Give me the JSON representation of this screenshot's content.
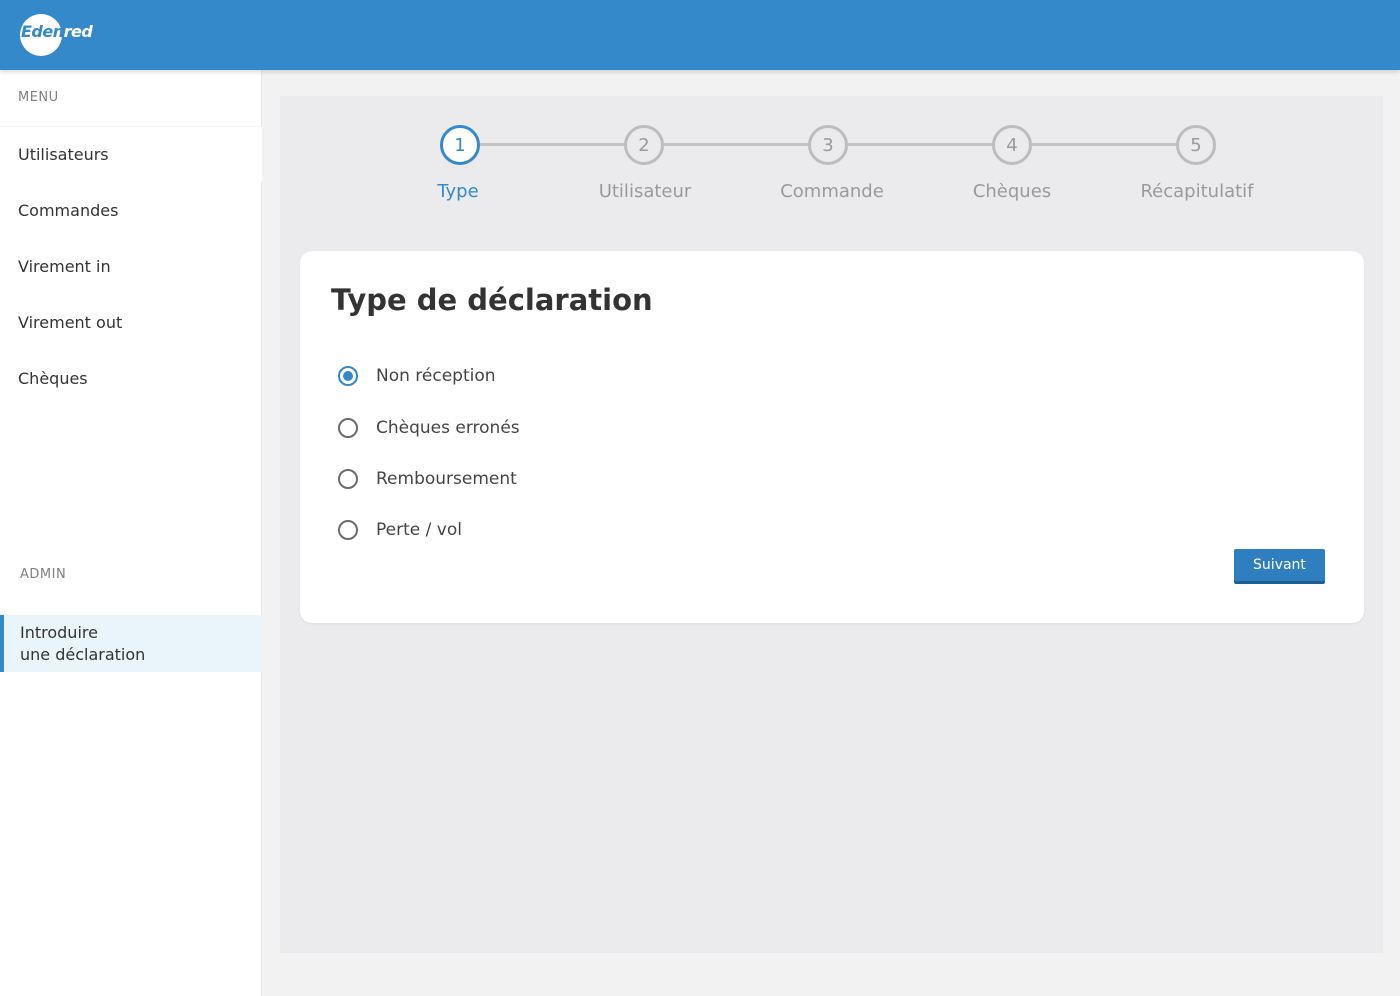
{
  "brand": {
    "logo_part_a": "Eden",
    "logo_part_b": "red",
    "accent_color": "#3389c9"
  },
  "sidebar": {
    "menu_heading": "MENU",
    "items": [
      {
        "label": "Utilisateurs"
      },
      {
        "label": "Commandes"
      },
      {
        "label": "Virement in"
      },
      {
        "label": "Virement out"
      },
      {
        "label": "Chèques"
      }
    ],
    "admin_heading": "ADMIN",
    "admin_items": [
      {
        "label": "Introduire\nune déclaration",
        "active": true
      }
    ]
  },
  "stepper": {
    "steps": [
      {
        "number": "1",
        "label": "Type",
        "active": true
      },
      {
        "number": "2",
        "label": "Utilisateur",
        "active": false
      },
      {
        "number": "3",
        "label": "Commande",
        "active": false
      },
      {
        "number": "4",
        "label": "Chèques",
        "active": false
      },
      {
        "number": "5",
        "label": "Récapitulatif",
        "active": false
      }
    ]
  },
  "form": {
    "title": "Type de déclaration",
    "options": [
      {
        "label": "Non réception",
        "checked": true
      },
      {
        "label": "Chèques erronés",
        "checked": false
      },
      {
        "label": "Remboursement",
        "checked": false
      },
      {
        "label": "Perte / vol",
        "checked": false
      }
    ],
    "next_label": "Suivant"
  }
}
